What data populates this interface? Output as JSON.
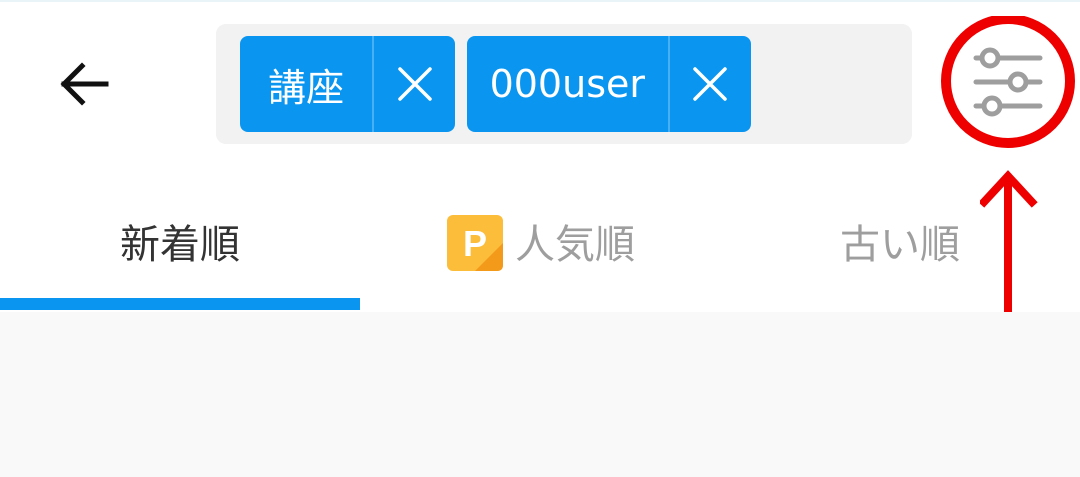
{
  "header": {
    "back_icon": "arrow-left-icon",
    "filter_icon": "sliders-icon",
    "filter_highlight_color": "#ee0000"
  },
  "search": {
    "chips": [
      {
        "label": "講座",
        "remove_icon": "close-icon"
      },
      {
        "label": "000user",
        "remove_icon": "close-icon"
      }
    ],
    "chip_color": "#0a96f0"
  },
  "tabs": {
    "items": [
      {
        "label": "新着順",
        "selected": true
      },
      {
        "label": "人気順",
        "selected": false,
        "icon": "premium-p-icon",
        "icon_text": "P"
      },
      {
        "label": "古い順",
        "selected": false
      }
    ],
    "indicator_color": "#0a96f0"
  }
}
